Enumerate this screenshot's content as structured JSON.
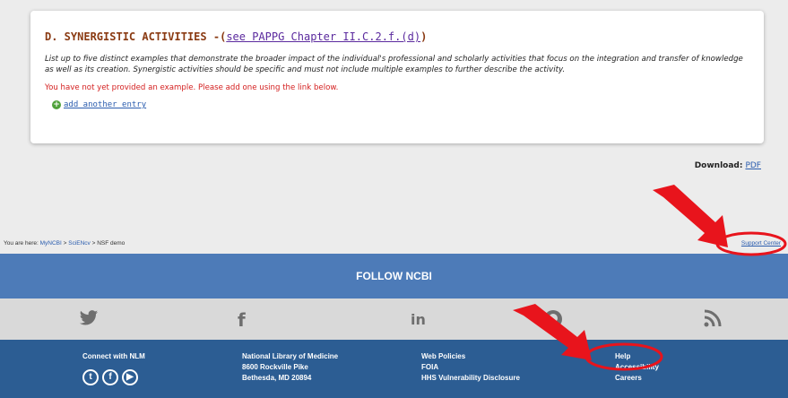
{
  "section": {
    "title": "D. SYNERGISTIC ACTIVITIES",
    "title_sep": " -(",
    "link": "see PAPPG Chapter II.C.2.f.(d)",
    "title_end": ")",
    "instructions": "List up to five distinct examples that demonstrate the broader impact of the individual's professional and scholarly activities that focus on the integration and transfer of knowledge as well as its creation. Synergistic activities should be specific and must not include multiple examples to further describe the activity.",
    "warning": "You have not yet provided an example. Please add one using the link below.",
    "add_entry": "add another entry"
  },
  "download": {
    "label": "Download:",
    "pdf": "PDF"
  },
  "breadcrumb": {
    "prefix": "You are here: ",
    "mync": "MyNCBI",
    "sep": " > ",
    "sci": "SciENcv",
    "demo": "NSF demo"
  },
  "support_center": "Support Center",
  "follow_bar": "FOLLOW NCBI",
  "social_icons": [
    "twitter-icon",
    "facebook-icon",
    "linkedin-icon",
    "github-icon",
    "rss-icon"
  ],
  "footer": {
    "connect_label": "Connect with NLM",
    "address": [
      "National Library of Medicine",
      "8600 Rockville Pike",
      "Bethesda, MD 20894"
    ],
    "policies": [
      "Web Policies",
      "FOIA",
      "HHS Vulnerability Disclosure"
    ],
    "help": [
      "Help",
      "Accessibility",
      "Careers"
    ]
  },
  "colors": {
    "annotation": "#e8141c",
    "follow_bar": "#4d7bb8",
    "footer": "#2c5d93"
  }
}
